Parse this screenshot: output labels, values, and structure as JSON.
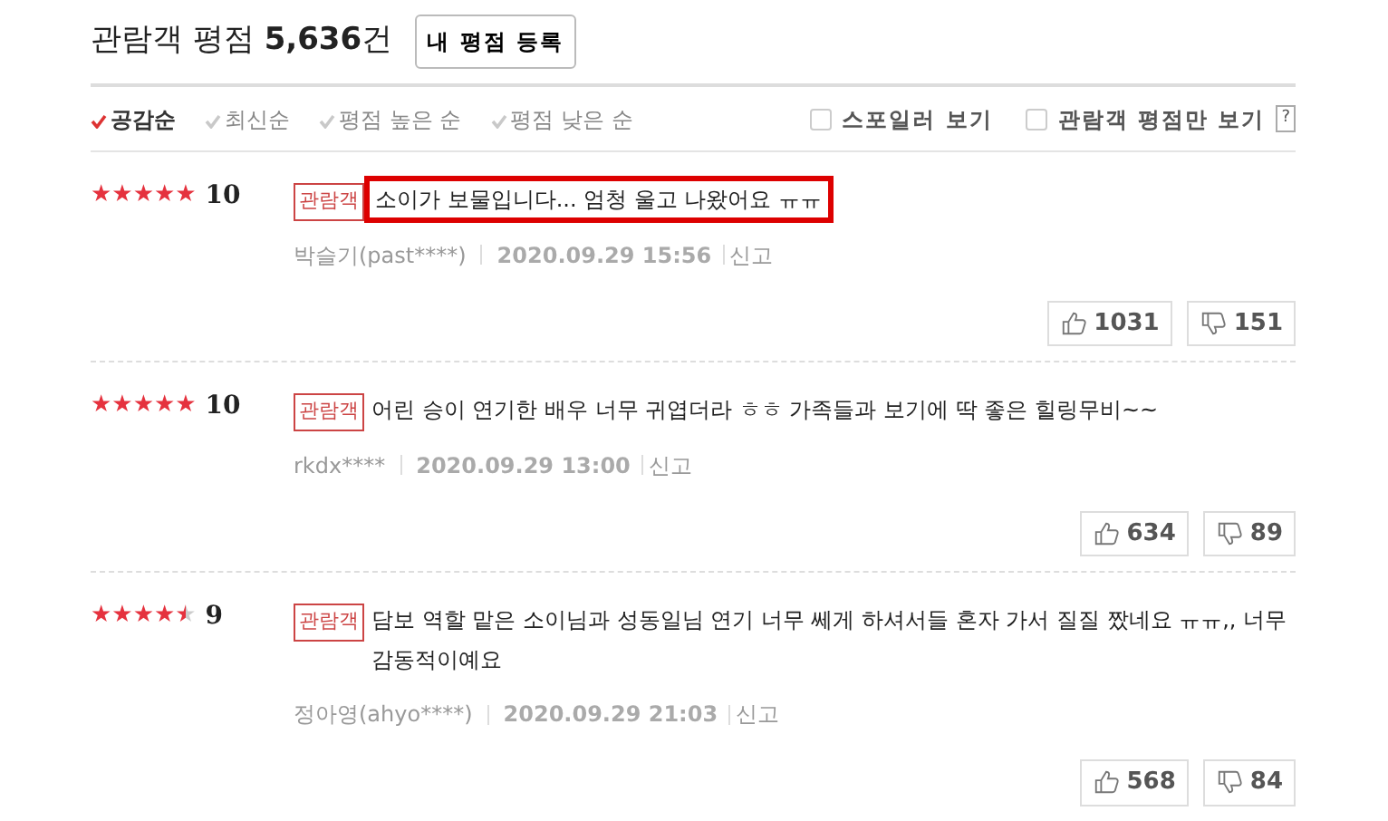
{
  "header": {
    "title": "관람객 평점",
    "count": "5,636",
    "count_unit": "건",
    "button": "내 평점 등록"
  },
  "sort_options": [
    {
      "label": "공감순",
      "selected": true
    },
    {
      "label": "최신순",
      "selected": false
    },
    {
      "label": "평점 높은 순",
      "selected": false
    },
    {
      "label": "평점 낮은 순",
      "selected": false
    }
  ],
  "filters": [
    {
      "label": "스포일러 보기",
      "checked": false
    },
    {
      "label": "관람객 평점만 보기",
      "checked": false
    }
  ],
  "help": "?",
  "reviews": [
    {
      "stars": 5,
      "score": "10",
      "badge": "관람객",
      "text": "소이가 보물입니다... 엄청 울고 나왔어요 ㅠㅠ",
      "highlighted": true,
      "author": "박슬기(past****)",
      "date": "2020.09.29 15:56",
      "report": "신고",
      "likes": "1031",
      "dislikes": "151"
    },
    {
      "stars": 5,
      "score": "10",
      "badge": "관람객",
      "text": "어린 승이 연기한 배우 너무 귀엽더라 ㅎㅎ 가족들과 보기에 딱 좋은 힐링무비~~",
      "highlighted": false,
      "author": "rkdx****",
      "date": "2020.09.29 13:00",
      "report": "신고",
      "likes": "634",
      "dislikes": "89"
    },
    {
      "stars": 4.5,
      "score": "9",
      "badge": "관람객",
      "text": "담보 역할 맡은 소이님과 성동일님 연기 너무 쎄게 하셔서들 혼자 가서 질질 짰네요 ㅠㅠ,, 너무 감동적이예요",
      "highlighted": false,
      "author": "정아영(ahyo****)",
      "date": "2020.09.29 21:03",
      "report": "신고",
      "likes": "568",
      "dislikes": "84"
    }
  ]
}
